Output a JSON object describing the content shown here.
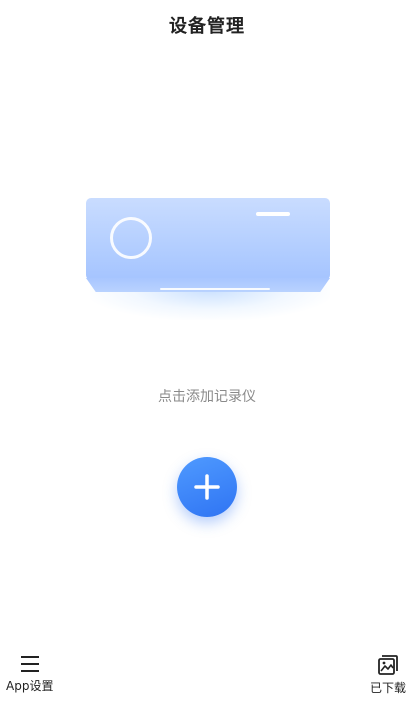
{
  "header": {
    "title": "设备管理"
  },
  "main": {
    "hint": "点击添加记录仪"
  },
  "bottom_nav": {
    "left_label": "App设置",
    "right_label": "已下载"
  },
  "colors": {
    "accent": "#2f74f3",
    "device": "#b3ceff"
  },
  "icons": {
    "add": "plus-icon",
    "menu": "menu-icon",
    "downloaded": "image-gallery-icon"
  }
}
